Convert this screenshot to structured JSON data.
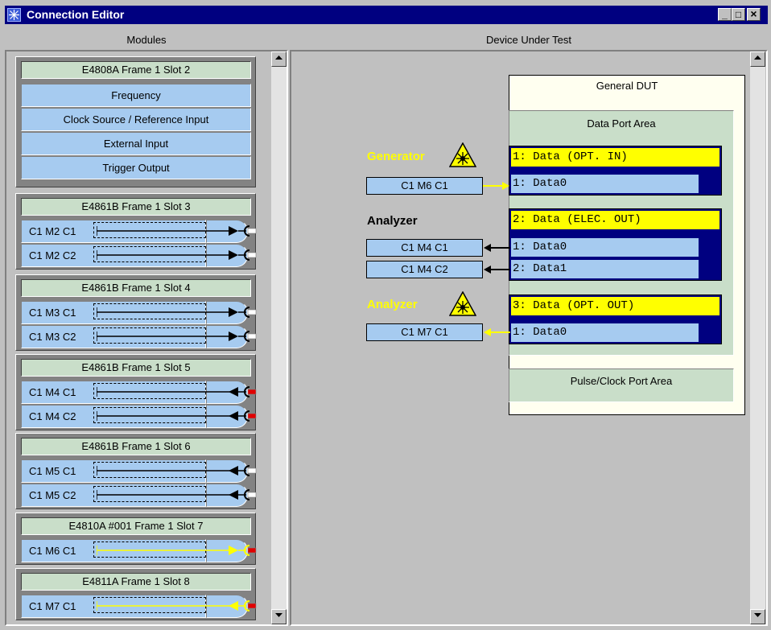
{
  "window": {
    "title": "Connection Editor",
    "controls": {
      "minimize": "_",
      "maximize": "□",
      "close": "×"
    }
  },
  "headers": {
    "left": "Modules",
    "right": "Device Under Test"
  },
  "modules": [
    {
      "title": "E4808A  Frame 1  Slot 2",
      "functions": [
        "Frequency",
        "Clock Source / Reference Input",
        "External Input",
        "Trigger Output"
      ]
    },
    {
      "title": "E4861B  Frame 1  Slot 3",
      "channels": [
        "C1 M2 C1",
        "C1 M2 C2"
      ],
      "direction": "out",
      "color": "#000000",
      "connector": "#ffffff"
    },
    {
      "title": "E4861B  Frame 1  Slot 4",
      "channels": [
        "C1 M3 C1",
        "C1 M3 C2"
      ],
      "direction": "out",
      "color": "#000000",
      "connector": "#ffffff"
    },
    {
      "title": "E4861B  Frame 1  Slot 5",
      "channels": [
        "C1 M4 C1",
        "C1 M4 C2"
      ],
      "direction": "in",
      "color": "#000000",
      "connector": "#e00000"
    },
    {
      "title": "E4861B  Frame 1  Slot 6",
      "channels": [
        "C1 M5 C1",
        "C1 M5 C2"
      ],
      "direction": "in",
      "color": "#000000",
      "connector": "#ffffff"
    },
    {
      "title": "E4810A #001  Frame 1  Slot 7",
      "channels": [
        "C1 M6 C1"
      ],
      "direction": "out",
      "color": "#ffff00",
      "connector": "#e00000"
    },
    {
      "title": "E4811A  Frame 1  Slot 8",
      "channels": [
        "C1 M7 C1"
      ],
      "direction": "in",
      "color": "#ffff00",
      "connector": "#e00000"
    }
  ],
  "dut": {
    "title": "General DUT",
    "data_area": "Data Port Area",
    "pulse_area": "Pulse/Clock Port Area",
    "ports": [
      {
        "header": "1: Data (OPT. IN)",
        "rows": [
          "1: Data0"
        ]
      },
      {
        "header": "2: Data (ELEC. OUT)",
        "rows": [
          "1: Data0",
          "2: Data1"
        ]
      },
      {
        "header": "3: Data (OPT. OUT)",
        "rows": [
          "1: Data0"
        ]
      }
    ]
  },
  "connections": [
    {
      "role": "Generator",
      "role_color": "#ffff00",
      "laser_icon": "laser-warning-icon",
      "channels": [
        "C1 M6 C1"
      ],
      "arrow_color": "#ffff00"
    },
    {
      "role": "Analyzer",
      "role_color": "#000000",
      "channels": [
        "C1 M4 C1",
        "C1 M4 C2"
      ],
      "arrow_color": "#000000"
    },
    {
      "role": "Analyzer",
      "role_color": "#ffff00",
      "laser_icon": "laser-warning-icon",
      "channels": [
        "C1 M7 C1"
      ],
      "arrow_color": "#ffff00"
    }
  ]
}
